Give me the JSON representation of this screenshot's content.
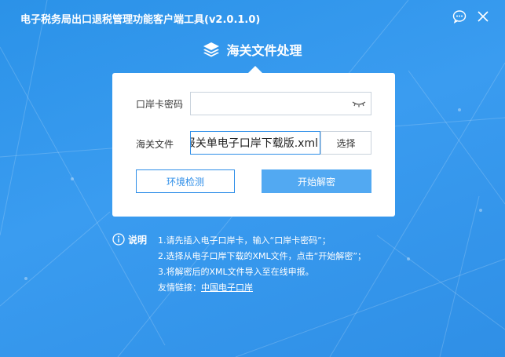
{
  "window": {
    "title": "电子税务局出口退税管理功能客户端工具(v2.0.1.0)",
    "controls": [
      "chat-icon",
      "close-icon"
    ]
  },
  "heading": {
    "icon": "layers-icon",
    "text": "海关文件处理"
  },
  "form": {
    "password_label": "口岸卡密码",
    "password_value": "",
    "password_toggle_icon": "eye-closed-icon",
    "file_label": "海关文件",
    "file_value": "报关单电子口岸下载版.xml",
    "select_button": "选择",
    "env_check_button": "环境检测",
    "start_decrypt_button": "开始解密"
  },
  "notes": {
    "icon": "info-icon",
    "title": "说明",
    "lines": [
      "1.请先插入电子口岸卡，输入“口岸卡密码”；",
      "2.选择从电子口岸下载的XML文件，点击“开始解密”；",
      "3.将解密后的XML文件导入至在线申报。"
    ],
    "link_prefix": "友情链接：",
    "link_text": "中国电子口岸"
  },
  "colors": {
    "background": "#3a9cf0",
    "accent": "#2e8ee8",
    "primary_button": "#52a9f2"
  }
}
